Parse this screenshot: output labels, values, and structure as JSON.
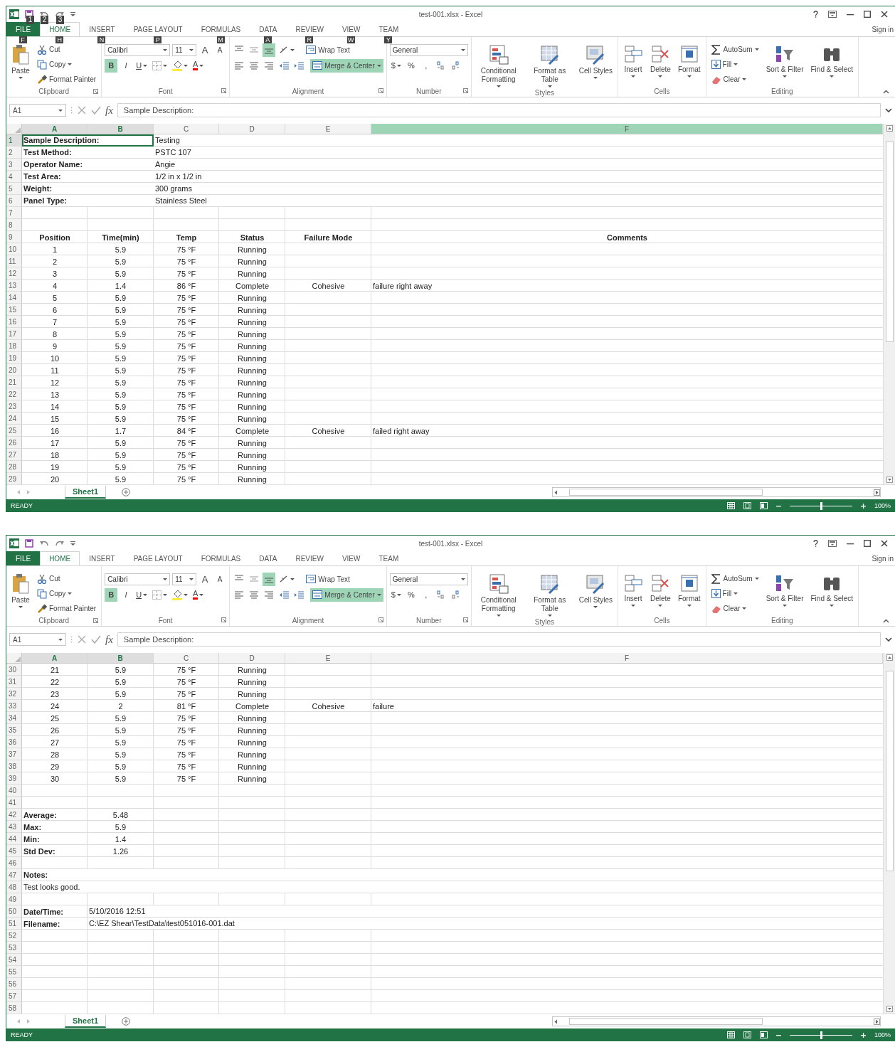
{
  "windows": [
    {
      "title": "test-001.xlsx - Excel",
      "qat_keytips": [
        "1",
        "2",
        "3"
      ],
      "sign_in": "Sign in",
      "tabs": [
        {
          "label": "FILE",
          "kind": "file",
          "selected": false,
          "keytip": "F"
        },
        {
          "label": "HOME",
          "kind": "tab",
          "selected": true,
          "keytip": "H"
        },
        {
          "label": "INSERT",
          "kind": "tab",
          "selected": false,
          "keytip": "N"
        },
        {
          "label": "PAGE LAYOUT",
          "kind": "tab",
          "selected": false,
          "keytip": "P"
        },
        {
          "label": "FORMULAS",
          "kind": "tab",
          "selected": false,
          "keytip": "M"
        },
        {
          "label": "DATA",
          "kind": "tab",
          "selected": false,
          "keytip": "A"
        },
        {
          "label": "REVIEW",
          "kind": "tab",
          "selected": false,
          "keytip": "R"
        },
        {
          "label": "VIEW",
          "kind": "tab",
          "selected": false,
          "keytip": "W"
        },
        {
          "label": "TEAM",
          "kind": "tab",
          "selected": false,
          "keytip": "Y"
        }
      ],
      "ribbon": [
        {
          "kind": "clipboard",
          "name": "Clipboard",
          "launcher": true,
          "paste": "Paste",
          "items": [
            "Cut",
            "Copy",
            "Format Painter"
          ]
        },
        {
          "kind": "font",
          "name": "Font",
          "launcher": true,
          "font": "Calibri",
          "size": "11",
          "grow": "A",
          "shrink": "A",
          "styles": [
            {
              "label": "B",
              "on": true
            },
            {
              "label": "I",
              "on": false
            },
            {
              "label": "U",
              "on": false
            }
          ],
          "color_letter": "A"
        },
        {
          "kind": "alignment",
          "name": "Alignment",
          "launcher": true,
          "vertical": [
            false,
            false,
            true
          ],
          "wrap": {
            "label": "Wrap Text",
            "on": false
          },
          "merge": {
            "label": "Merge & Center",
            "on": true
          }
        },
        {
          "kind": "number",
          "name": "Number",
          "launcher": true,
          "format": "General",
          "symbols": [
            "$",
            "%",
            ","
          ]
        },
        {
          "kind": "styles",
          "name": "Styles",
          "launcher": false,
          "items": [
            "Conditional Formatting",
            "Format as Table",
            "Cell Styles"
          ]
        },
        {
          "kind": "cells",
          "name": "Cells",
          "launcher": false,
          "items": [
            "Insert",
            "Delete",
            "Format"
          ]
        },
        {
          "kind": "editing",
          "name": "Editing",
          "launcher": false,
          "small": [
            "AutoSum",
            "Fill",
            "Clear"
          ],
          "items": [
            "Sort & Filter",
            "Find & Select"
          ]
        }
      ],
      "name_box": "A1",
      "function_label": "fx",
      "formula": "Sample Description:",
      "columns": [
        {
          "label": "A",
          "selected": true,
          "highlighted": false
        },
        {
          "label": "B",
          "selected": true,
          "highlighted": false
        },
        {
          "label": "C",
          "selected": false,
          "highlighted": false
        },
        {
          "label": "D",
          "selected": false,
          "highlighted": false
        },
        {
          "label": "E",
          "selected": false,
          "highlighted": false
        },
        {
          "label": "F",
          "selected": false,
          "highlighted": true
        }
      ],
      "rows": [
        {
          "num": "1",
          "kind": "info",
          "selected": true,
          "cells": [
            "Sample Description:",
            null,
            "Testing"
          ]
        },
        {
          "num": "2",
          "kind": "info",
          "selected": false,
          "cells": [
            "Test Method:",
            null,
            "PSTC 107"
          ]
        },
        {
          "num": "3",
          "kind": "info",
          "selected": false,
          "cells": [
            "Operator Name:",
            null,
            "Angie"
          ]
        },
        {
          "num": "4",
          "kind": "info",
          "selected": false,
          "cells": [
            "Test Area:",
            null,
            "1/2 in x 1/2 in"
          ]
        },
        {
          "num": "5",
          "kind": "info",
          "selected": false,
          "cells": [
            "Weight:",
            null,
            "300 grams"
          ]
        },
        {
          "num": "6",
          "kind": "info",
          "selected": false,
          "cells": [
            "Panel Type:",
            null,
            "Stainless Steel"
          ]
        },
        {
          "num": "7",
          "kind": "empty",
          "selected": false
        },
        {
          "num": "8",
          "kind": "empty",
          "selected": false
        },
        {
          "num": "9",
          "kind": "header",
          "selected": false,
          "cells": [
            "Position",
            "Time(min)",
            "Temp",
            "Status",
            "Failure Mode",
            "Comments"
          ]
        },
        {
          "num": "10",
          "kind": "data",
          "selected": false,
          "cells": [
            "1",
            "5.9",
            "75 °F",
            "Running"
          ]
        },
        {
          "num": "11",
          "kind": "data",
          "selected": false,
          "cells": [
            "2",
            "5.9",
            "75 °F",
            "Running"
          ]
        },
        {
          "num": "12",
          "kind": "data",
          "selected": false,
          "cells": [
            "3",
            "5.9",
            "75 °F",
            "Running"
          ]
        },
        {
          "num": "13",
          "kind": "data",
          "selected": false,
          "cells": [
            "4",
            "1.4",
            "86 °F",
            "Complete",
            "Cohesive",
            "failure right away"
          ]
        },
        {
          "num": "14",
          "kind": "data",
          "selected": false,
          "cells": [
            "5",
            "5.9",
            "75 °F",
            "Running"
          ]
        },
        {
          "num": "15",
          "kind": "data",
          "selected": false,
          "cells": [
            "6",
            "5.9",
            "75 °F",
            "Running"
          ]
        },
        {
          "num": "16",
          "kind": "data",
          "selected": false,
          "cells": [
            "7",
            "5.9",
            "75 °F",
            "Running"
          ]
        },
        {
          "num": "17",
          "kind": "data",
          "selected": false,
          "cells": [
            "8",
            "5.9",
            "75 °F",
            "Running"
          ]
        },
        {
          "num": "18",
          "kind": "data",
          "selected": false,
          "cells": [
            "9",
            "5.9",
            "75 °F",
            "Running"
          ]
        },
        {
          "num": "19",
          "kind": "data",
          "selected": false,
          "cells": [
            "10",
            "5.9",
            "75 °F",
            "Running"
          ]
        },
        {
          "num": "20",
          "kind": "data",
          "selected": false,
          "cells": [
            "11",
            "5.9",
            "75 °F",
            "Running"
          ]
        },
        {
          "num": "21",
          "kind": "data",
          "selected": false,
          "cells": [
            "12",
            "5.9",
            "75 °F",
            "Running"
          ]
        },
        {
          "num": "22",
          "kind": "data",
          "selected": false,
          "cells": [
            "13",
            "5.9",
            "75 °F",
            "Running"
          ]
        },
        {
          "num": "23",
          "kind": "data",
          "selected": false,
          "cells": [
            "14",
            "5.9",
            "75 °F",
            "Running"
          ]
        },
        {
          "num": "24",
          "kind": "data",
          "selected": false,
          "cells": [
            "15",
            "5.9",
            "75 °F",
            "Running"
          ]
        },
        {
          "num": "25",
          "kind": "data",
          "selected": false,
          "cells": [
            "16",
            "1.7",
            "84 °F",
            "Complete",
            "Cohesive",
            "failed right away"
          ]
        },
        {
          "num": "26",
          "kind": "data",
          "selected": false,
          "cells": [
            "17",
            "5.9",
            "75 °F",
            "Running"
          ]
        },
        {
          "num": "27",
          "kind": "data",
          "selected": false,
          "cells": [
            "18",
            "5.9",
            "75 °F",
            "Running"
          ]
        },
        {
          "num": "28",
          "kind": "data",
          "selected": false,
          "cells": [
            "19",
            "5.9",
            "75 °F",
            "Running"
          ]
        },
        {
          "num": "29",
          "kind": "data",
          "selected": false,
          "cells": [
            "20",
            "5.9",
            "75 °F",
            "Running"
          ]
        }
      ],
      "sheet_tab": "Sheet1",
      "status": "READY",
      "zoom": {
        "level": 0.5,
        "reading": "100%"
      }
    },
    {
      "title": "test-001.xlsx - Excel",
      "sign_in": "Sign in",
      "tabs": [
        {
          "label": "FILE",
          "kind": "file",
          "selected": false
        },
        {
          "label": "HOME",
          "kind": "tab",
          "selected": true
        },
        {
          "label": "INSERT",
          "kind": "tab",
          "selected": false
        },
        {
          "label": "PAGE LAYOUT",
          "kind": "tab",
          "selected": false
        },
        {
          "label": "FORMULAS",
          "kind": "tab",
          "selected": false
        },
        {
          "label": "DATA",
          "kind": "tab",
          "selected": false
        },
        {
          "label": "REVIEW",
          "kind": "tab",
          "selected": false
        },
        {
          "label": "VIEW",
          "kind": "tab",
          "selected": false
        },
        {
          "label": "TEAM",
          "kind": "tab",
          "selected": false
        }
      ],
      "ribbon": [
        {
          "kind": "clipboard",
          "name": "Clipboard",
          "launcher": true,
          "paste": "Paste",
          "items": [
            "Cut",
            "Copy",
            "Format Painter"
          ]
        },
        {
          "kind": "font",
          "name": "Font",
          "launcher": true,
          "font": "Calibri",
          "size": "11",
          "grow": "A",
          "shrink": "A",
          "styles": [
            {
              "label": "B",
              "on": true
            },
            {
              "label": "I",
              "on": false
            },
            {
              "label": "U",
              "on": false
            }
          ],
          "color_letter": "A"
        },
        {
          "kind": "alignment",
          "name": "Alignment",
          "launcher": true,
          "vertical": [
            false,
            false,
            true
          ],
          "wrap": {
            "label": "Wrap Text",
            "on": false
          },
          "merge": {
            "label": "Merge & Center",
            "on": true
          }
        },
        {
          "kind": "number",
          "name": "Number",
          "launcher": true,
          "format": "General",
          "symbols": [
            "$",
            "%",
            ","
          ]
        },
        {
          "kind": "styles",
          "name": "Styles",
          "launcher": false,
          "items": [
            "Conditional Formatting",
            "Format as Table",
            "Cell Styles"
          ]
        },
        {
          "kind": "cells",
          "name": "Cells",
          "launcher": false,
          "items": [
            "Insert",
            "Delete",
            "Format"
          ]
        },
        {
          "kind": "editing",
          "name": "Editing",
          "launcher": false,
          "small": [
            "AutoSum",
            "Fill",
            "Clear"
          ],
          "items": [
            "Sort & Filter",
            "Find & Select"
          ]
        }
      ],
      "name_box": "A1",
      "function_label": "fx",
      "formula": "Sample Description:",
      "columns": [
        {
          "label": "A",
          "selected": true,
          "highlighted": false
        },
        {
          "label": "B",
          "selected": true,
          "highlighted": false
        },
        {
          "label": "C",
          "selected": false,
          "highlighted": false
        },
        {
          "label": "D",
          "selected": false,
          "highlighted": false
        },
        {
          "label": "E",
          "selected": false,
          "highlighted": false
        },
        {
          "label": "F",
          "selected": false,
          "highlighted": false
        }
      ],
      "rows": [
        {
          "num": "30",
          "kind": "data",
          "selected": false,
          "cells": [
            "21",
            "5.9",
            "75 °F",
            "Running"
          ]
        },
        {
          "num": "31",
          "kind": "data",
          "selected": false,
          "cells": [
            "22",
            "5.9",
            "75 °F",
            "Running"
          ]
        },
        {
          "num": "32",
          "kind": "data",
          "selected": false,
          "cells": [
            "23",
            "5.9",
            "75 °F",
            "Running"
          ]
        },
        {
          "num": "33",
          "kind": "data",
          "selected": false,
          "cells": [
            "24",
            "2",
            "81 °F",
            "Complete",
            "Cohesive",
            "failure"
          ]
        },
        {
          "num": "34",
          "kind": "data",
          "selected": false,
          "cells": [
            "25",
            "5.9",
            "75 °F",
            "Running"
          ]
        },
        {
          "num": "35",
          "kind": "data",
          "selected": false,
          "cells": [
            "26",
            "5.9",
            "75 °F",
            "Running"
          ]
        },
        {
          "num": "36",
          "kind": "data",
          "selected": false,
          "cells": [
            "27",
            "5.9",
            "75 °F",
            "Running"
          ]
        },
        {
          "num": "37",
          "kind": "data",
          "selected": false,
          "cells": [
            "28",
            "5.9",
            "75 °F",
            "Running"
          ]
        },
        {
          "num": "38",
          "kind": "data",
          "selected": false,
          "cells": [
            "29",
            "5.9",
            "75 °F",
            "Running"
          ]
        },
        {
          "num": "39",
          "kind": "data",
          "selected": false,
          "cells": [
            "30",
            "5.9",
            "75 °F",
            "Running"
          ]
        },
        {
          "num": "40",
          "kind": "empty",
          "selected": false
        },
        {
          "num": "41",
          "kind": "empty",
          "selected": false
        },
        {
          "num": "42",
          "kind": "stat",
          "selected": false,
          "cells": [
            "Average:",
            "5.48"
          ]
        },
        {
          "num": "43",
          "kind": "stat",
          "selected": false,
          "cells": [
            "Max:",
            "5.9"
          ]
        },
        {
          "num": "44",
          "kind": "stat",
          "selected": false,
          "cells": [
            "Min:",
            "1.4"
          ]
        },
        {
          "num": "45",
          "kind": "stat",
          "selected": false,
          "cells": [
            "Std Dev:",
            "1.26"
          ]
        },
        {
          "num": "46",
          "kind": "empty",
          "selected": false
        },
        {
          "num": "47",
          "kind": "heading",
          "selected": false,
          "cells": [
            "Notes:"
          ]
        },
        {
          "num": "48",
          "kind": "note",
          "selected": false,
          "cells": [
            "Test looks good."
          ]
        },
        {
          "num": "49",
          "kind": "empty",
          "selected": false
        },
        {
          "num": "50",
          "kind": "info",
          "selected": false,
          "cells": [
            "Date/Time:",
            "5/10/2016 12:51"
          ]
        },
        {
          "num": "51",
          "kind": "info",
          "selected": false,
          "cells": [
            "Filename:",
            "C:\\EZ Shear\\TestData\\test051016-001.dat"
          ]
        },
        {
          "num": "52",
          "kind": "empty",
          "selected": false
        },
        {
          "num": "53",
          "kind": "empty",
          "selected": false
        },
        {
          "num": "54",
          "kind": "empty",
          "selected": false
        },
        {
          "num": "55",
          "kind": "empty",
          "selected": false
        },
        {
          "num": "56",
          "kind": "empty",
          "selected": false
        },
        {
          "num": "57",
          "kind": "empty",
          "selected": false
        },
        {
          "num": "58",
          "kind": "empty",
          "selected": false
        }
      ],
      "sheet_tab": "Sheet1",
      "status": "READY",
      "zoom": {
        "level": 0.5,
        "reading": "100%"
      }
    }
  ]
}
